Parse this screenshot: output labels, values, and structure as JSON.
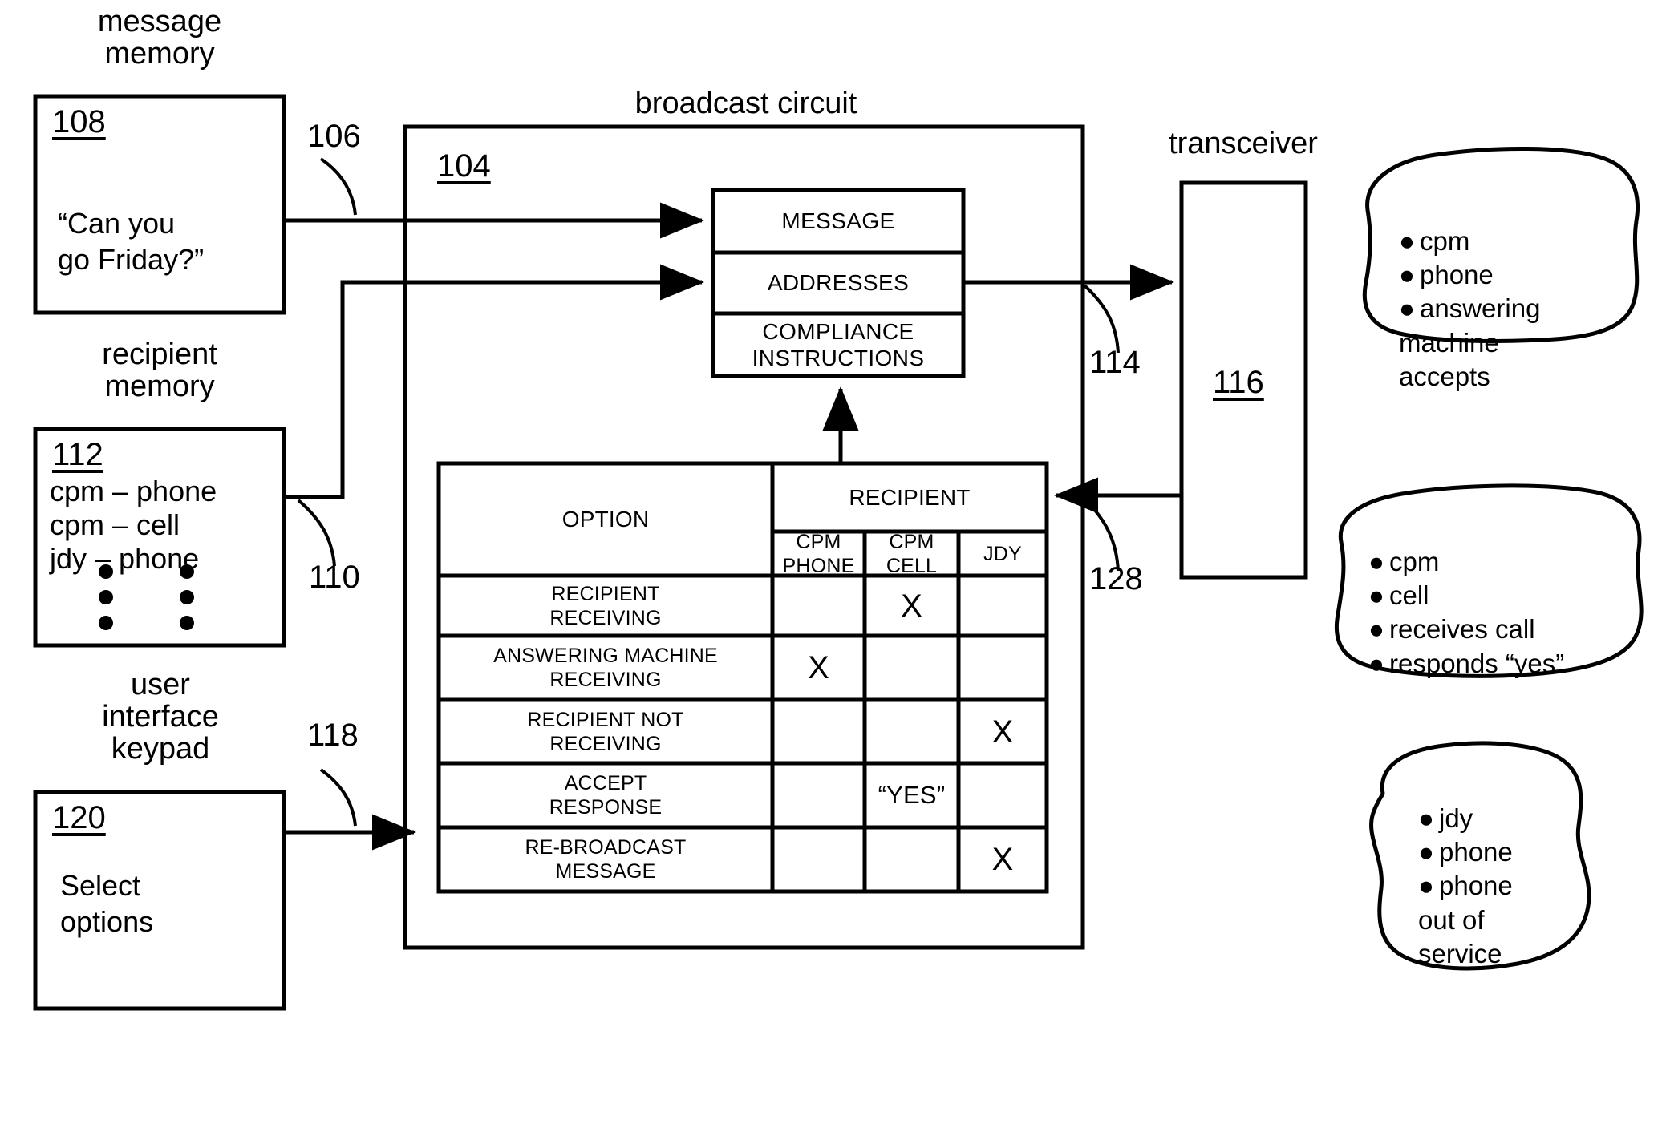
{
  "figure": {
    "type": "patent-block-diagram",
    "captions": {
      "message_memory": "message\nmemory",
      "recipient_memory": "recipient\nmemory",
      "user_interface_keypad": "user\ninterface\nkeypad",
      "broadcast_circuit": "broadcast circuit",
      "transceiver": "transceiver"
    },
    "blocks": {
      "message_memory": {
        "ref": "108",
        "body": "“Can you\ngo Friday?”"
      },
      "recipient_memory": {
        "ref": "112",
        "lines": [
          "cpm – phone",
          "cpm – cell",
          "jdy – phone"
        ],
        "ellipsis": "vertical-dots"
      },
      "user_interface_keypad": {
        "ref": "120",
        "body": "Select\noptions"
      },
      "broadcast_circuit": {
        "ref": "104"
      },
      "transceiver": {
        "ref": "116"
      }
    },
    "packet_stack": {
      "rows": [
        "MESSAGE",
        "ADDRESSES",
        "COMPLIANCE\nINSTRUCTIONS"
      ]
    },
    "lead_lines": {
      "message_to_circuit": "106",
      "recipient_to_circuit": "110",
      "keypad_to_circuit": "118",
      "circuit_to_transceiver": "114",
      "transceiver_to_table": "128"
    }
  },
  "option_table": {
    "corner_header": "OPTION",
    "group_header": "RECIPIENT",
    "columns": [
      "CPM\nPHONE",
      "CPM\nCELL",
      "JDY"
    ],
    "rows": [
      {
        "option": "RECIPIENT\nRECEIVING",
        "cells": [
          "",
          "X",
          ""
        ]
      },
      {
        "option": "ANSWERING MACHINE\nRECEIVING",
        "cells": [
          "X",
          "",
          ""
        ]
      },
      {
        "option": "RECIPIENT NOT\nRECEIVING",
        "cells": [
          "",
          "",
          "X"
        ]
      },
      {
        "option": "ACCEPT\nRESPONSE",
        "cells": [
          "",
          "“YES”",
          ""
        ]
      },
      {
        "option": "RE-BROADCAST\nMESSAGE",
        "cells": [
          "",
          "",
          "X"
        ]
      }
    ]
  },
  "callouts": [
    {
      "id": "callout-answering-machine",
      "bullets": [
        "cpm",
        "phone",
        "answering"
      ],
      "continuation": [
        "machine",
        "accepts"
      ]
    },
    {
      "id": "callout-cell-responds-yes",
      "bullets": [
        "cpm",
        "cell",
        "receives call",
        "responds “yes”"
      ],
      "continuation": []
    },
    {
      "id": "callout-jdy-out-of-service",
      "bullets": [
        "jdy",
        "phone",
        "phone"
      ],
      "continuation": [
        "out of",
        "service"
      ]
    }
  ],
  "colors": {
    "ink": "#000000",
    "paper": "#ffffff"
  }
}
